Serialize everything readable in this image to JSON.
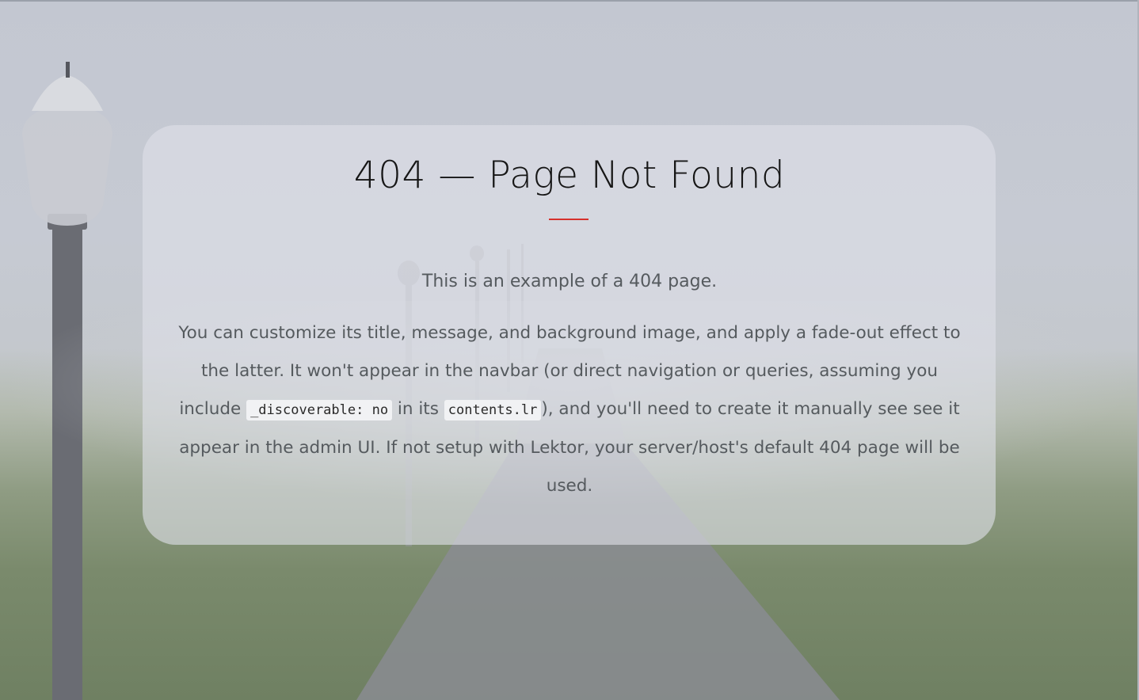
{
  "page": {
    "title": "404 — Page Not Found",
    "lead": "This is an example of a 404 page.",
    "body": {
      "part1": "You can customize its title, message, and background image, and apply a fade-out effect to the latter. It won't appear in the navbar (or direct navigation or queries, assuming you include ",
      "code1": "_discoverable: no",
      "part2": " in its ",
      "code2": "contents.lr",
      "part3": "), and you'll need to create it manually see see it appear in the admin UI. If not setup with Lektor, your server/host's default 404 page will be used."
    }
  },
  "colors": {
    "accent": "#d6302c",
    "text": "#555a5e",
    "title": "#161616"
  }
}
